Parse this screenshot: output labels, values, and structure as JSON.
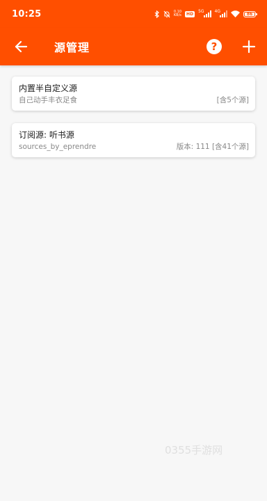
{
  "status_bar": {
    "time": "10:25",
    "net_speed_value": "0.10",
    "net_speed_unit": "KB/s",
    "hd_tag": "HD",
    "signal_1_label": "5G",
    "signal_2_label": "4G",
    "battery_level": "86",
    "icons": [
      "bluetooth-icon",
      "mute-icon",
      "signal-icon",
      "wifi-icon",
      "battery-icon"
    ]
  },
  "app_bar": {
    "title": "源管理",
    "background": "#ff4f00",
    "help_symbol": "?",
    "icons": [
      "back-arrow-icon",
      "help-icon",
      "plus-icon"
    ]
  },
  "sources": [
    {
      "title": "内置半自定义源",
      "subtitle": "自己动手丰衣足食",
      "meta": "[含5个源]"
    },
    {
      "title": "订阅源: 听书源",
      "subtitle": "sources_by_eprendre",
      "meta": "版本: 111 [含41个源]"
    }
  ],
  "watermark": "0355手游网"
}
